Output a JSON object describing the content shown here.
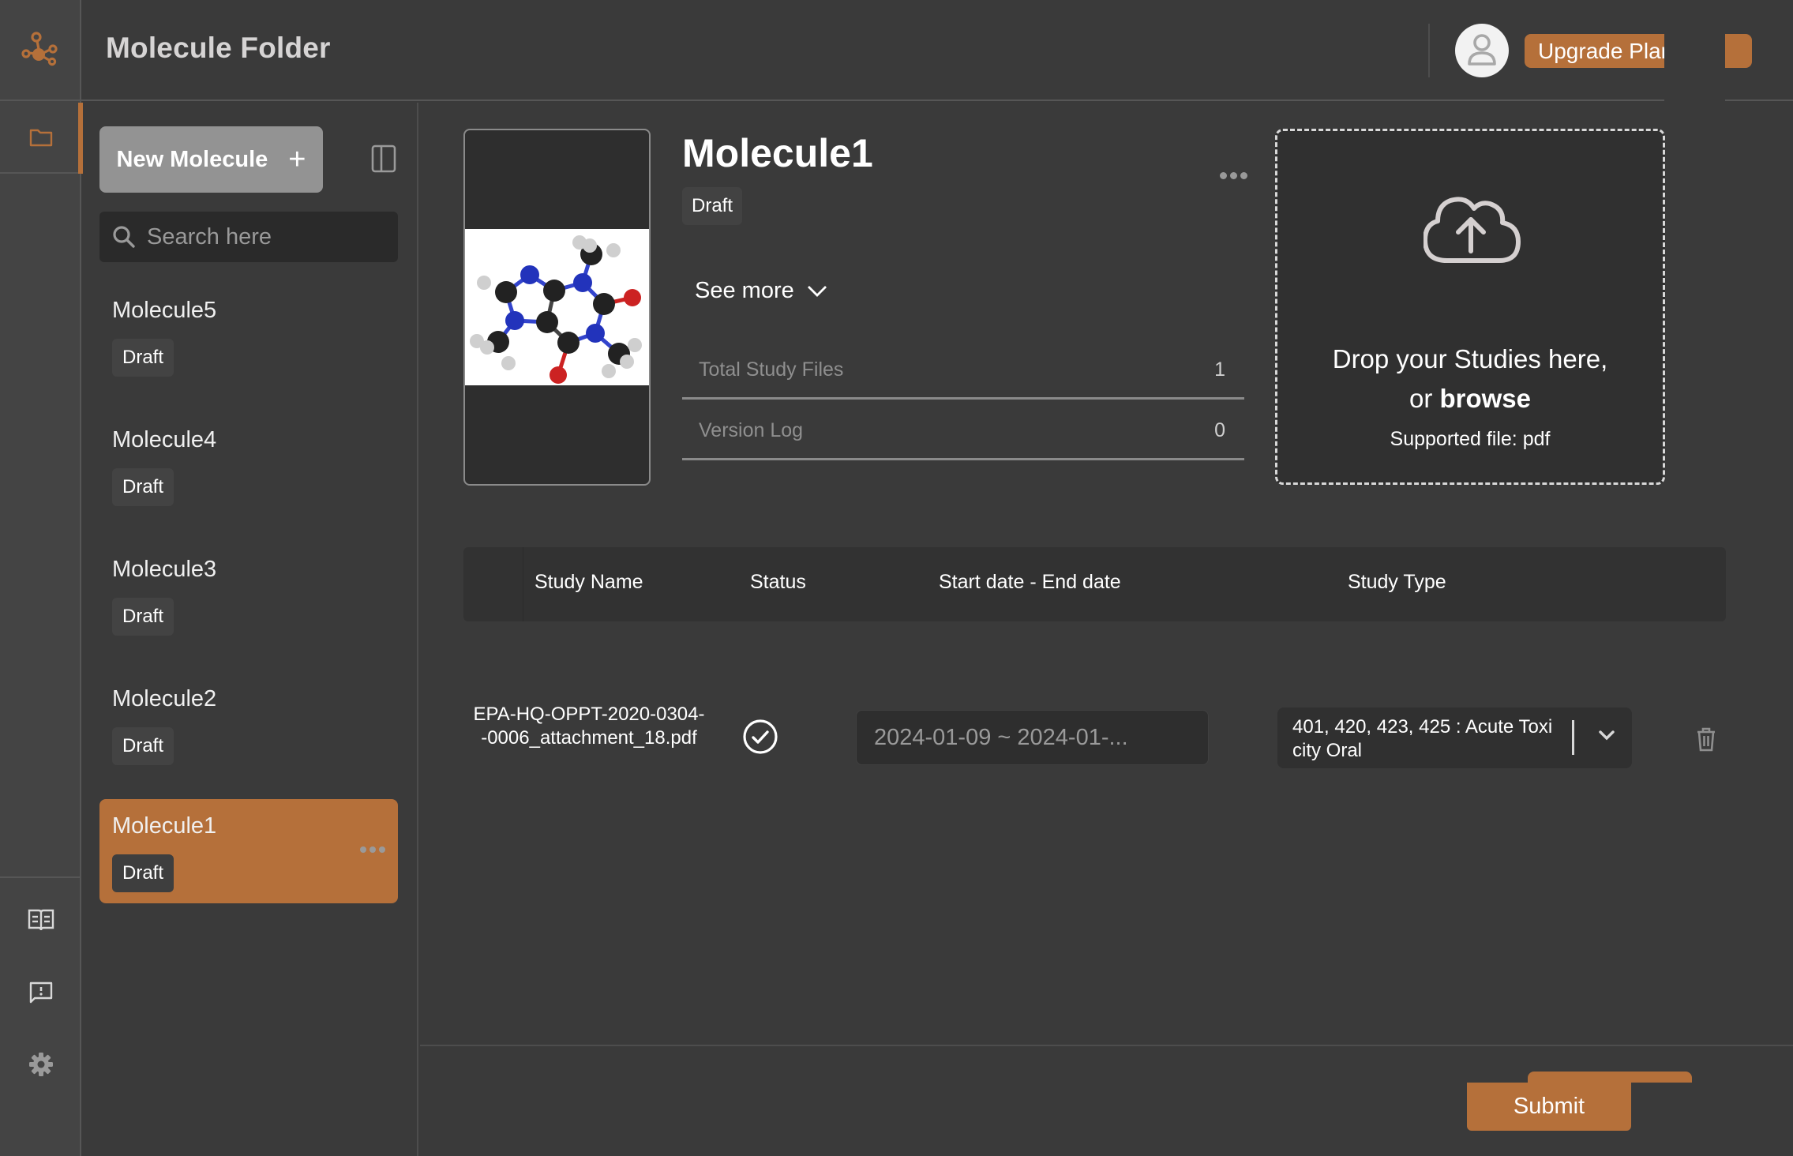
{
  "app": {
    "title": "Molecule Folder",
    "accent_color": "#b5703a"
  },
  "rail": {
    "logo_icon": "molecule-logo-icon",
    "items": [
      {
        "name": "folder",
        "icon": "folder-icon",
        "active": true
      },
      {
        "name": "docs",
        "icon": "open-book-icon",
        "active": false
      },
      {
        "name": "feedback",
        "icon": "feedback-message-icon",
        "active": false
      },
      {
        "name": "settings",
        "icon": "gear-icon",
        "active": false
      }
    ]
  },
  "header": {
    "avatar_icon": "user-icon",
    "upgrade_label": "Upgrade Plan"
  },
  "list_panel": {
    "new_button_label": "New Molecule",
    "new_button_icon": "+",
    "search_placeholder": "Search here",
    "molecules": [
      {
        "name": "Molecule5",
        "status": "Draft",
        "active": false
      },
      {
        "name": "Molecule4",
        "status": "Draft",
        "active": false
      },
      {
        "name": "Molecule3",
        "status": "Draft",
        "active": false
      },
      {
        "name": "Molecule2",
        "status": "Draft",
        "active": false
      },
      {
        "name": "Molecule1",
        "status": "Draft",
        "active": true
      }
    ]
  },
  "detail": {
    "title": "Molecule1",
    "status": "Draft",
    "see_more_label": "See more",
    "stats": [
      {
        "label": "Total Study Files",
        "value": "1"
      },
      {
        "label": "Version Log",
        "value": "0"
      }
    ],
    "image_alt": "Caffeine ball-and-stick model"
  },
  "dropzone": {
    "line1": "Drop your Studies here,",
    "line2_prefix": "or ",
    "line2_link": "browse",
    "supported": "Supported file: pdf"
  },
  "table": {
    "columns": [
      "Study Name",
      "Status",
      "Start date - End date",
      "Study Type"
    ],
    "rows": [
      {
        "study_name": "EPA-HQ-OPPT-2020-0304--0006_attachment_18.pdf",
        "status": "complete",
        "date_range": "2024-01-09 ~ 2024-01-...",
        "study_type": "401, 420, 423, 425 : Acute Toxicity Oral"
      }
    ]
  },
  "footer": {
    "submit_label": "Submit"
  }
}
